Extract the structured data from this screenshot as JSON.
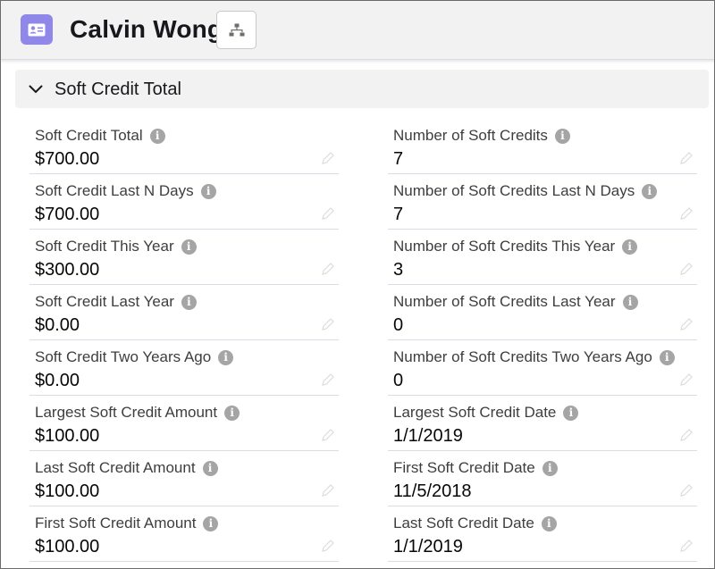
{
  "record": {
    "title": "Calvin Wong",
    "icon": "contact-card-icon",
    "hierarchy_icon": "hierarchy-icon"
  },
  "section": {
    "title": "Soft Credit Total",
    "expanded": true
  },
  "colors": {
    "header_bg": "#f3f2f2",
    "record_icon_bg": "#8f88e8",
    "info_icon": "#a5a5a5",
    "divider": "#d8dde6"
  },
  "fields_left": [
    {
      "label": "Soft Credit Total",
      "value": "$700.00"
    },
    {
      "label": "Soft Credit Last N Days",
      "value": "$700.00"
    },
    {
      "label": "Soft Credit This Year",
      "value": "$300.00"
    },
    {
      "label": "Soft Credit Last Year",
      "value": "$0.00"
    },
    {
      "label": "Soft Credit Two Years Ago",
      "value": "$0.00"
    },
    {
      "label": "Largest Soft Credit Amount",
      "value": "$100.00"
    },
    {
      "label": "Last Soft Credit Amount",
      "value": "$100.00"
    },
    {
      "label": "First Soft Credit Amount",
      "value": "$100.00"
    }
  ],
  "fields_right": [
    {
      "label": "Number of Soft Credits",
      "value": "7"
    },
    {
      "label": "Number of Soft Credits Last N Days",
      "value": "7"
    },
    {
      "label": "Number of Soft Credits This Year",
      "value": "3"
    },
    {
      "label": "Number of Soft Credits Last Year",
      "value": "0"
    },
    {
      "label": "Number of Soft Credits Two Years Ago",
      "value": "0"
    },
    {
      "label": "Largest Soft Credit Date",
      "value": "1/1/2019"
    },
    {
      "label": "First Soft Credit Date",
      "value": "11/5/2018"
    },
    {
      "label": "Last Soft Credit Date",
      "value": "1/1/2019"
    }
  ]
}
